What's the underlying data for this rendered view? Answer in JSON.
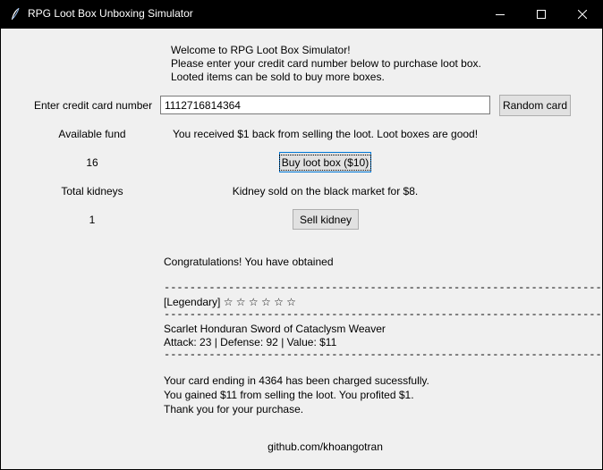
{
  "window": {
    "title": "RPG Loot Box Unboxing Simulator",
    "icon": "feather-icon"
  },
  "intro": {
    "line1": "Welcome to RPG Loot Box Simulator!",
    "line2": "Please enter your credit card number below to purchase loot box.",
    "line3": "Looted items can be sold to buy more boxes."
  },
  "card": {
    "label": "Enter credit card number",
    "value": "1112716814364",
    "random_button": "Random card"
  },
  "funds": {
    "label": "Available fund",
    "value": "16",
    "message": "You received $1 back from selling the loot. Loot boxes are good!",
    "buy_button": "Buy loot box ($10)"
  },
  "kidneys": {
    "label": "Total kidneys",
    "value": "1",
    "message": "Kidney sold on the black market for $8.",
    "sell_button": "Sell kidney"
  },
  "result": {
    "congrats": "Congratulations! You have obtained",
    "separator": "--------------------------------------------------------------------",
    "rarity": "[Legendary] ☆ ☆ ☆ ☆ ☆ ☆",
    "item_name": "Scarlet Honduran Sword of Cataclysm Weaver",
    "item_stats": "Attack: 23 | Defense: 92 | Value: $11",
    "receipt1": "Your card ending in 4364 has been charged sucessfully.",
    "receipt2": "You gained $11 from selling the loot. You profited $1.",
    "receipt3": "Thank you for your purchase."
  },
  "footer": {
    "link": "github.com/khoangotran"
  }
}
